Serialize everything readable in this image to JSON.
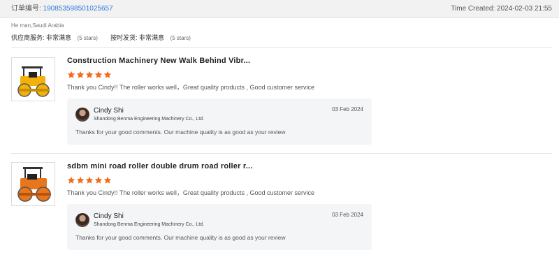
{
  "order": {
    "label": "订单编号:",
    "number": "190853598501025657",
    "created": "Time Created: 2024-02-03 21:55"
  },
  "buyer": {
    "info": "He man,Saudi Arabia",
    "supplier_service_label": "供应商服务:",
    "supplier_service_value": "非常满意",
    "supplier_service_stars": "(5 stars)",
    "on_time_label": "按时发货:",
    "on_time_value": "非常满意",
    "on_time_stars": "(5 stars)"
  },
  "colors": {
    "star": "#f26c1d",
    "link": "#2f7ad8"
  },
  "items": [
    {
      "title": "Construction Machinery New Walk Behind Vibr...",
      "rating": 5,
      "review": "Thank you Cindy!!  The roller works well，Great quality products , Good customer service",
      "image_icon": "road-roller-yellow",
      "reply": {
        "name": "Cindy Shi",
        "company": "Shandong Benma Engineering Machinery Co., Ltd.",
        "date": "03 Feb 2024",
        "text": "Thanks for your good comments. Our machine quality is as good as your review"
      }
    },
    {
      "title": "sdbm mini road roller double drum road roller r...",
      "rating": 5,
      "review": "Thank you Cindy!!  The roller works well，Great quality products , Good customer service",
      "image_icon": "road-roller-orange",
      "reply": {
        "name": "Cindy Shi",
        "company": "Shandong Benma Engineering Machinery Co., Ltd.",
        "date": "03 Feb 2024",
        "text": "Thanks for your good comments. Our machine quality is as good as your review"
      }
    }
  ]
}
